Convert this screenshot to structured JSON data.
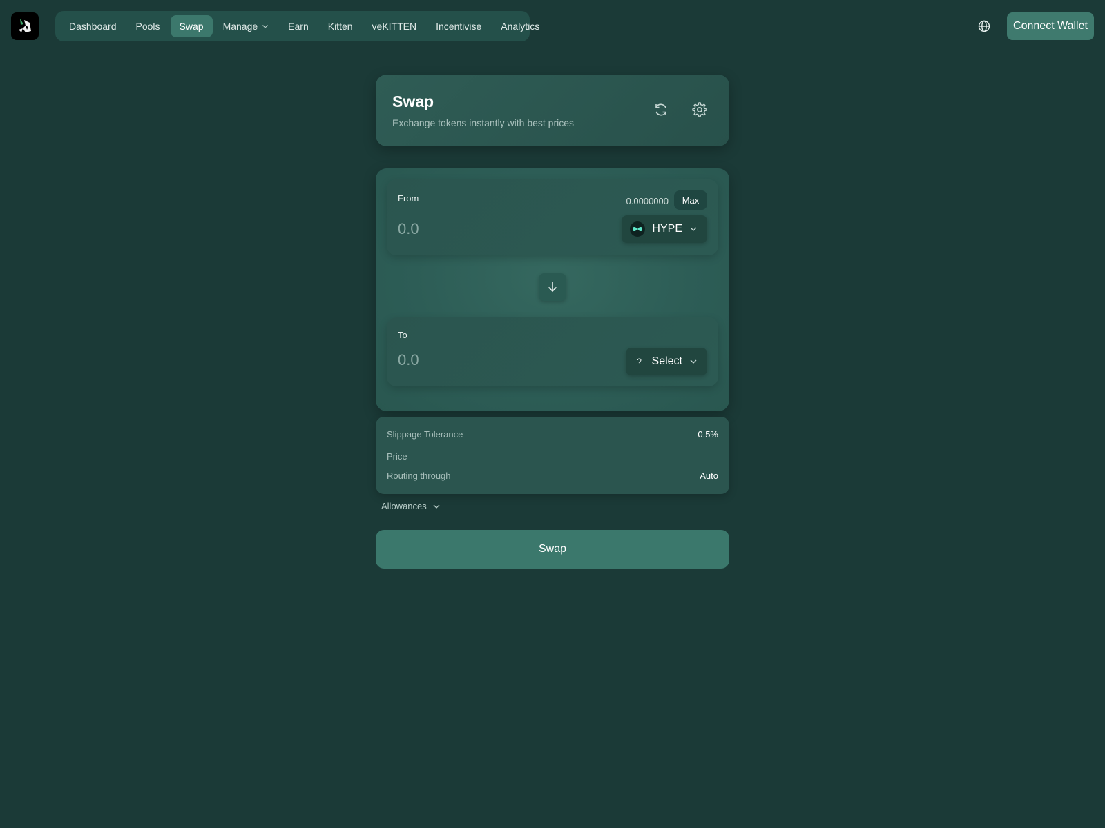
{
  "nav": {
    "items": [
      {
        "label": "Dashboard",
        "active": false
      },
      {
        "label": "Pools",
        "active": false
      },
      {
        "label": "Swap",
        "active": true
      },
      {
        "label": "Manage",
        "active": false,
        "dropdown": true
      },
      {
        "label": "Earn",
        "active": false
      },
      {
        "label": "Kitten",
        "active": false
      },
      {
        "label": "veKITTEN",
        "active": false
      },
      {
        "label": "Incentivise",
        "active": false
      },
      {
        "label": "Analytics",
        "active": false
      }
    ]
  },
  "header": {
    "connect_label": "Connect Wallet",
    "globe_icon": "globe-icon"
  },
  "swap_header": {
    "title": "Swap",
    "subtitle": "Exchange tokens instantly with best prices",
    "refresh_icon": "refresh-icon",
    "settings_icon": "gear-icon"
  },
  "from": {
    "label": "From",
    "balance": "0.0000000",
    "max_label": "Max",
    "amount_placeholder": "0.0",
    "token": "HYPE"
  },
  "to": {
    "label": "To",
    "amount_placeholder": "0.0",
    "token_placeholder_icon": "?",
    "token": "Select"
  },
  "details": {
    "slippage_label": "Slippage Tolerance",
    "slippage_value": "0.5%",
    "price_label": "Price",
    "routing_label": "Routing through",
    "routing_value": "Auto"
  },
  "allowances_label": "Allowances",
  "swap_button_label": "Swap",
  "colors": {
    "background": "#1b3a37",
    "accent": "#3b786c",
    "card": "#2b554f",
    "hype_accent": "#5ee6c8"
  }
}
